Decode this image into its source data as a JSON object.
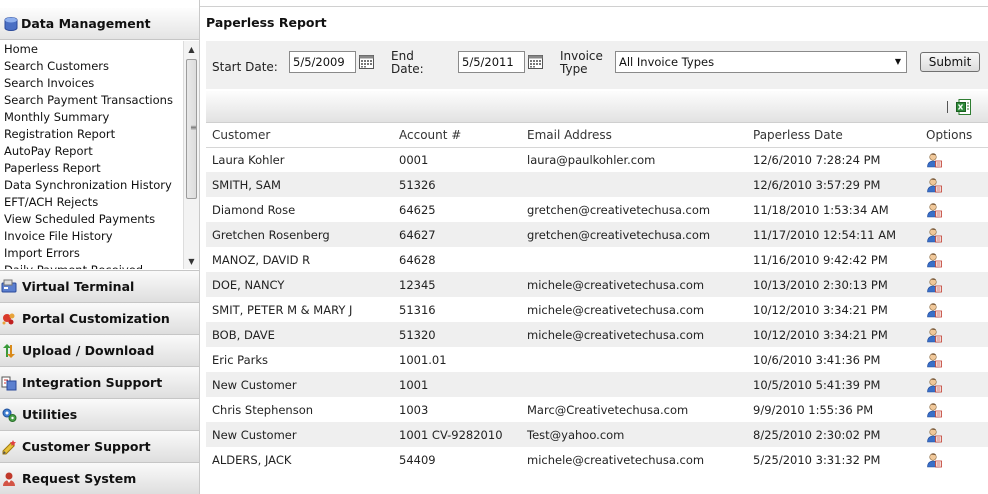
{
  "sidebar": {
    "header": "Data Management",
    "items": [
      "Home",
      "Search Customers",
      "Search Invoices",
      "Search Payment Transactions",
      "Monthly Summary",
      "Registration Report",
      "AutoPay Report",
      "Paperless Report",
      "Data Synchronization History",
      "EFT/ACH Rejects",
      "View Scheduled Payments",
      "Invoice File History",
      "Import Errors",
      "Daily Payment Received"
    ],
    "sections": [
      "Virtual Terminal",
      "Portal Customization",
      "Upload / Download",
      "Integration Support",
      "Utilities",
      "Customer Support",
      "Request System"
    ]
  },
  "page": {
    "title": "Paperless Report"
  },
  "filter": {
    "start_label": "Start Date:",
    "start_value": "5/5/2009",
    "end_label_1": "End",
    "end_label_2": "Date:",
    "end_value": "5/5/2011",
    "type_label_1": "Invoice",
    "type_label_2": "Type",
    "type_value": "All Invoice Types",
    "submit": "Submit"
  },
  "table": {
    "columns": [
      "Customer",
      "Account #",
      "Email Address",
      "Paperless Date",
      "Options"
    ],
    "rows": [
      [
        "Laura Kohler",
        "0001",
        "laura@paulkohler.com",
        "12/6/2010 7:28:24 PM"
      ],
      [
        "SMITH, SAM",
        "51326",
        "",
        "12/6/2010 3:57:29 PM"
      ],
      [
        "Diamond Rose",
        "64625",
        "gretchen@creativetechusa.com",
        "11/18/2010 1:53:34 AM"
      ],
      [
        "Gretchen Rosenberg",
        "64627",
        "gretchen@creativetechusa.com",
        "11/17/2010 12:54:11 AM"
      ],
      [
        "MANOZ, DAVID R",
        "64628",
        "",
        "11/16/2010 9:42:42 PM"
      ],
      [
        "DOE, NANCY",
        "12345",
        "michele@creativetechusa.com",
        "10/13/2010 2:30:13 PM"
      ],
      [
        "SMIT, PETER M & MARY J",
        "51316",
        "michele@creativetechusa.com",
        "10/12/2010 3:34:21 PM"
      ],
      [
        "BOB, DAVE",
        "51320",
        "michele@creativetechusa.com",
        "10/12/2010 3:34:21 PM"
      ],
      [
        "Eric Parks",
        "1001.01",
        "",
        "10/6/2010 3:41:36 PM"
      ],
      [
        "New Customer",
        "1001",
        "",
        "10/5/2010 5:41:39 PM"
      ],
      [
        "Chris Stephenson",
        "1003",
        "Marc@Creativetechusa.com",
        "9/9/2010 1:55:36 PM"
      ],
      [
        "New Customer",
        "1001 CV-9282010",
        "Test@yahoo.com",
        "8/25/2010 2:30:02 PM"
      ],
      [
        "ALDERS, JACK",
        "54409",
        "michele@creativetechusa.com",
        "5/25/2010 3:31:32 PM"
      ]
    ]
  },
  "icons": {
    "data_management": "database-icon",
    "row_option": "user-edit-icon",
    "export": "excel-export-icon"
  }
}
